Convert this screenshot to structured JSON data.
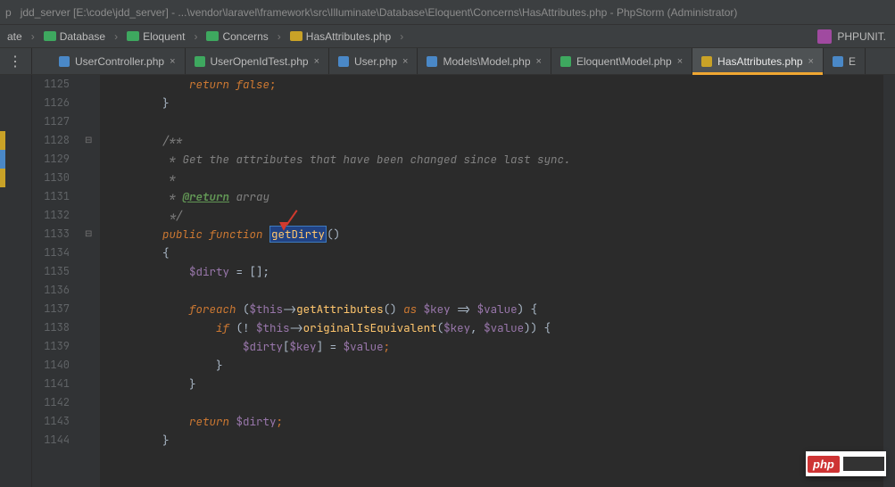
{
  "title": "jdd_server [E:\\code\\jdd_server] - ...\\vendor\\laravel\\framework\\src\\Illuminate\\Database\\Eloquent\\Concerns\\HasAttributes.php - PhpStorm (Administrator)",
  "breadcrumbs": {
    "items": [
      {
        "label": "ate",
        "icon": "none"
      },
      {
        "label": "Database",
        "icon": "folder-green"
      },
      {
        "label": "Eloquent",
        "icon": "folder-green"
      },
      {
        "label": "Concerns",
        "icon": "folder-green"
      },
      {
        "label": "HasAttributes.php",
        "icon": "php-yellow"
      }
    ],
    "right_tool": "PHPUNIT."
  },
  "tabs": [
    {
      "label": "UserController.php",
      "icon": "blue",
      "active": false
    },
    {
      "label": "UserOpenIdTest.php",
      "icon": "green",
      "active": false
    },
    {
      "label": "User.php",
      "icon": "blue",
      "active": false
    },
    {
      "label": "Models\\Model.php",
      "icon": "blue",
      "active": false
    },
    {
      "label": "Eloquent\\Model.php",
      "icon": "green",
      "active": false
    },
    {
      "label": "HasAttributes.php",
      "icon": "yellow",
      "active": true
    },
    {
      "label": "E",
      "icon": "blue",
      "active": false
    }
  ],
  "line_numbers": [
    "1125",
    "1126",
    "1127",
    "1128",
    "1129",
    "1130",
    "1131",
    "1132",
    "1133",
    "1134",
    "1135",
    "1136",
    "1137",
    "1138",
    "1139",
    "1140",
    "1141",
    "1142",
    "1143",
    "1144"
  ],
  "fold_marks": {
    "1128": "open",
    "1133": "open"
  },
  "code": {
    "l1125": {
      "indent": "            ",
      "k_return": "return ",
      "k_false": "false",
      "semi": ";"
    },
    "l1126": {
      "indent": "        ",
      "brace": "}"
    },
    "l1128": {
      "indent": "        ",
      "t": "/**"
    },
    "l1129": {
      "indent": "         ",
      "t": "* Get the attributes that have been changed since last sync."
    },
    "l1130": {
      "indent": "         ",
      "t": "*"
    },
    "l1131": {
      "indent": "         ",
      "t1": "* ",
      "tag": "@return",
      "t2": " array"
    },
    "l1132": {
      "indent": "         ",
      "t": "*/"
    },
    "l1133": {
      "indent": "        ",
      "k_public": "public ",
      "k_function": "function ",
      "fn": "getDirty",
      "parens": "()"
    },
    "l1134": {
      "indent": "        ",
      "brace": "{"
    },
    "l1135": {
      "indent": "            ",
      "v": "$dirty",
      "rest": " = [];"
    },
    "l1137": {
      "indent": "            ",
      "k_foreach": "foreach ",
      "p1": "(",
      "v_this": "$this",
      "arrow": "->",
      "fn_get": "getAttributes",
      "p2": "() ",
      "k_as": "as ",
      "v_key": "$key",
      "arr": " => ",
      "v_val": "$value",
      "p3": ") {"
    },
    "l1138": {
      "indent": "                ",
      "k_if": "if ",
      "p1": "(! ",
      "v_this": "$this",
      "arrow": "->",
      "fn_eq": "originalIsEquivalent",
      "p2": "(",
      "v_key": "$key",
      "c1": ", ",
      "v_val": "$value",
      "p3": ")) {"
    },
    "l1139": {
      "indent": "                    ",
      "v_dirty": "$dirty",
      "p1": "[",
      "v_key": "$key",
      "p2": "] = ",
      "v_val": "$value",
      "semi": ";"
    },
    "l1140": {
      "indent": "                ",
      "brace": "}"
    },
    "l1141": {
      "indent": "            ",
      "brace": "}"
    },
    "l1143": {
      "indent": "            ",
      "k_return": "return ",
      "v": "$dirty",
      "semi": ";"
    },
    "l1144": {
      "indent": "        ",
      "brace": "}"
    }
  },
  "badge": {
    "logo": "php"
  }
}
